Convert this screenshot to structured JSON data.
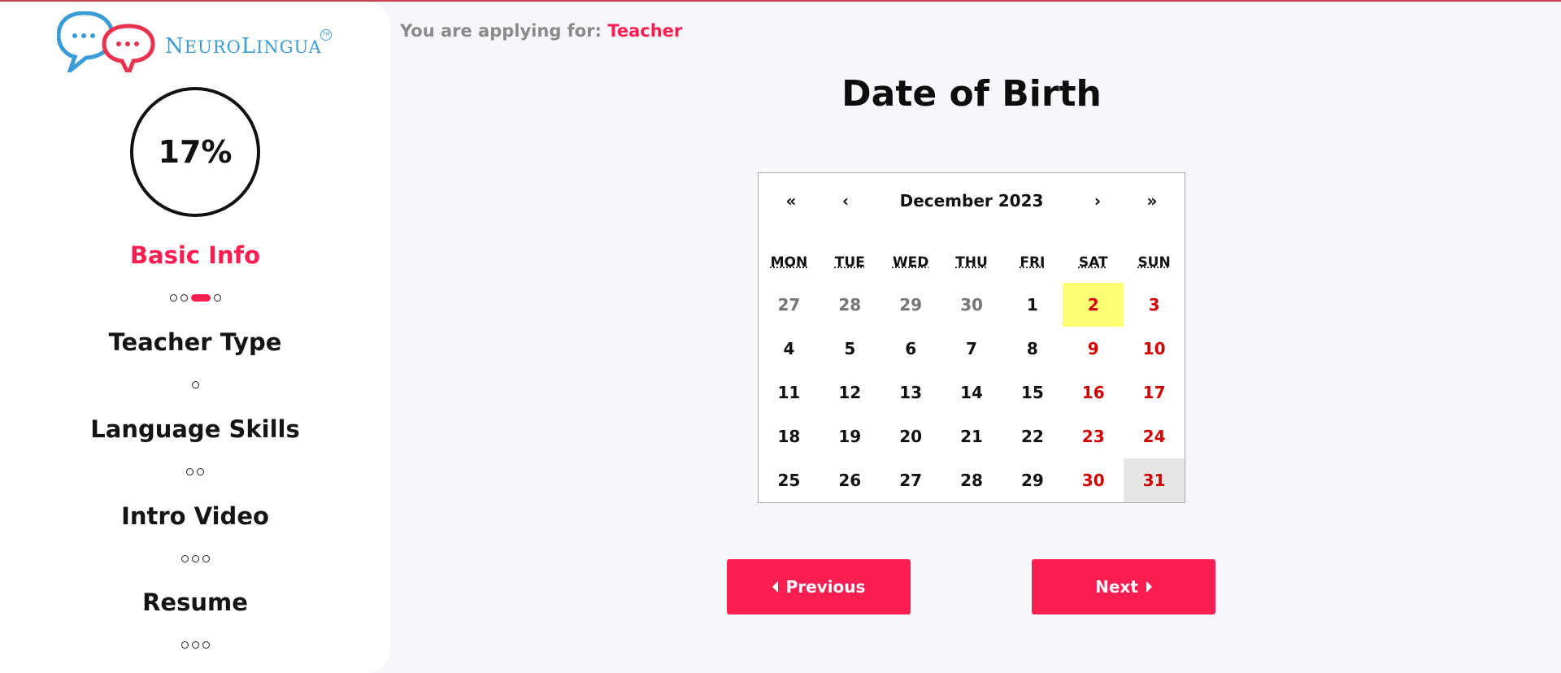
{
  "brand": {
    "logo_text_main": "N",
    "logo_text_small": "EURO",
    "logo_text_main2": "L",
    "logo_text_small2": "INGUA",
    "trademark": "TM",
    "primary_color": "#fc1d51",
    "logo_blue": "#3a9bd5"
  },
  "sidebar": {
    "progress": "17%",
    "steps": [
      {
        "title": "Basic Info",
        "dots": 4,
        "current_dot": 3,
        "active": true
      },
      {
        "title": "Teacher Type",
        "dots": 1,
        "active": false
      },
      {
        "title": "Language Skills",
        "dots": 2,
        "active": false
      },
      {
        "title": "Intro Video",
        "dots": 3,
        "active": false
      },
      {
        "title": "Resume",
        "dots": 3,
        "active": false
      }
    ]
  },
  "header": {
    "applying_prefix": "You are applying for:",
    "role": "Teacher"
  },
  "main": {
    "title": "Date of Birth"
  },
  "calendar": {
    "nav_prev2": "«",
    "nav_prev": "‹",
    "month_label": "December 2023",
    "nav_next": "›",
    "nav_next2": "»",
    "weekdays": [
      "MON",
      "TUE",
      "WED",
      "THU",
      "FRI",
      "SAT",
      "SUN"
    ],
    "days": [
      {
        "d": "27",
        "neighbor": true
      },
      {
        "d": "28",
        "neighbor": true
      },
      {
        "d": "29",
        "neighbor": true
      },
      {
        "d": "30",
        "neighbor": true
      },
      {
        "d": "1"
      },
      {
        "d": "2",
        "weekend": true,
        "today": true
      },
      {
        "d": "3",
        "weekend": true
      },
      {
        "d": "4"
      },
      {
        "d": "5"
      },
      {
        "d": "6"
      },
      {
        "d": "7"
      },
      {
        "d": "8"
      },
      {
        "d": "9",
        "weekend": true
      },
      {
        "d": "10",
        "weekend": true
      },
      {
        "d": "11"
      },
      {
        "d": "12"
      },
      {
        "d": "13"
      },
      {
        "d": "14"
      },
      {
        "d": "15"
      },
      {
        "d": "16",
        "weekend": true
      },
      {
        "d": "17",
        "weekend": true
      },
      {
        "d": "18"
      },
      {
        "d": "19"
      },
      {
        "d": "20"
      },
      {
        "d": "21"
      },
      {
        "d": "22"
      },
      {
        "d": "23",
        "weekend": true
      },
      {
        "d": "24",
        "weekend": true
      },
      {
        "d": "25"
      },
      {
        "d": "26"
      },
      {
        "d": "27"
      },
      {
        "d": "28"
      },
      {
        "d": "29"
      },
      {
        "d": "30",
        "weekend": true
      },
      {
        "d": "31",
        "weekend": true,
        "active": true
      }
    ]
  },
  "buttons": {
    "previous": "Previous",
    "next": "Next"
  }
}
